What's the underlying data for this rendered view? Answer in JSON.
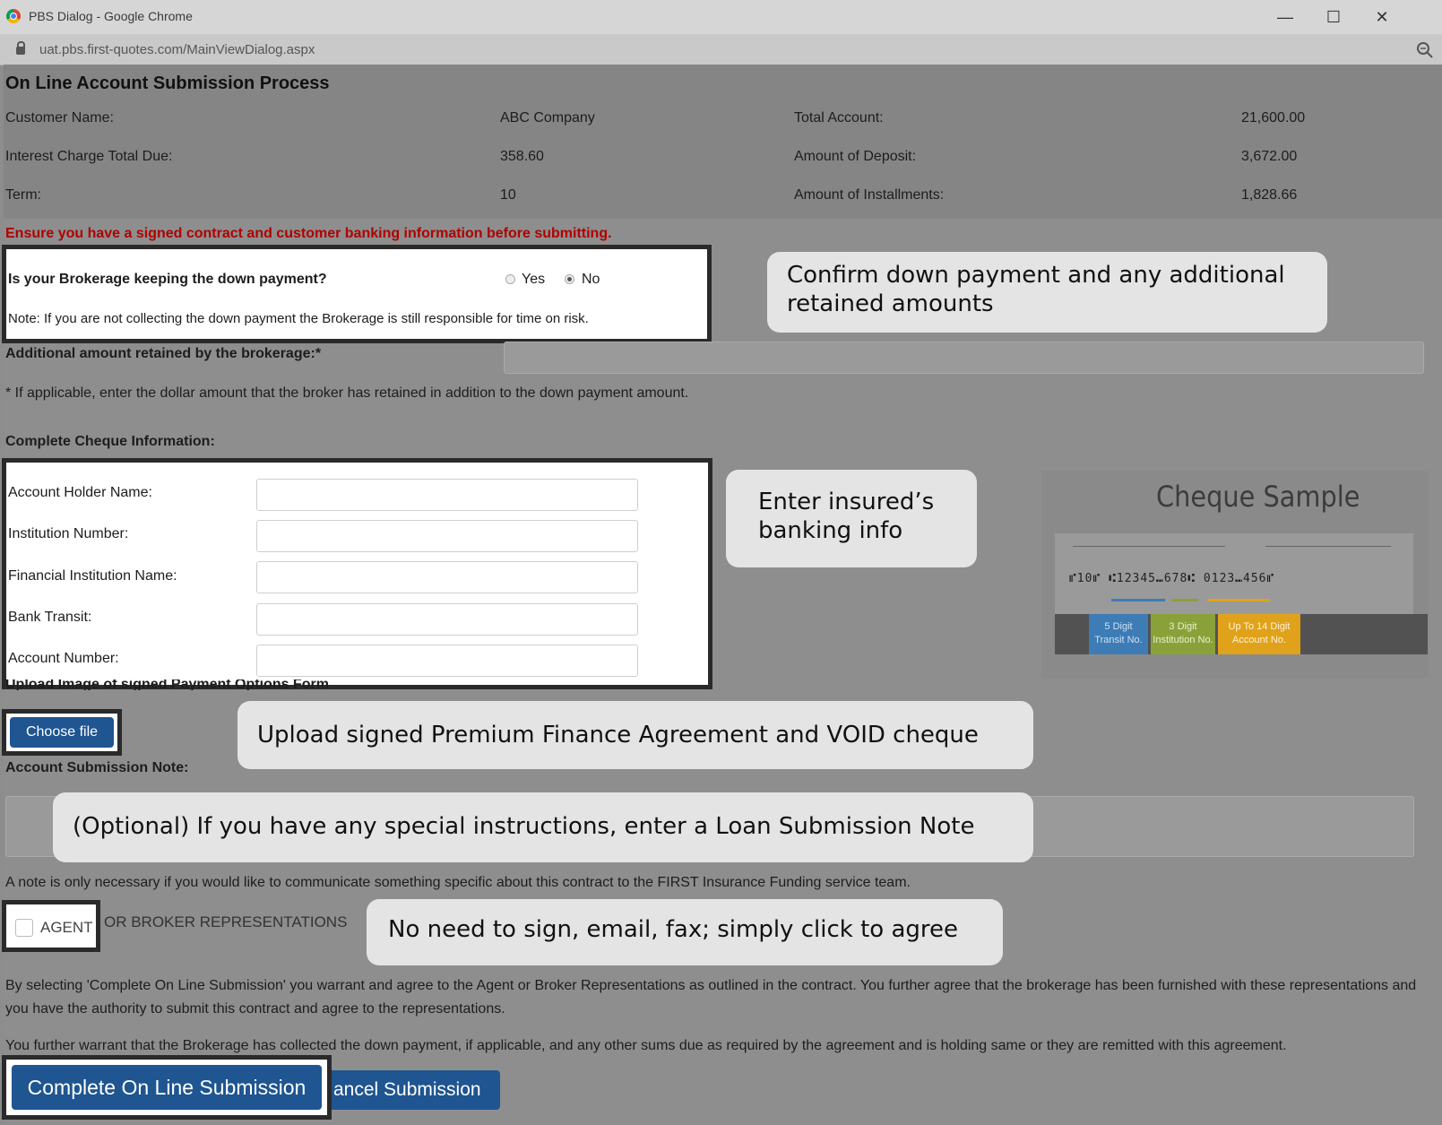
{
  "window": {
    "title": "PBS Dialog - Google Chrome",
    "url": "uat.pbs.first-quotes.com/MainViewDialog.aspx"
  },
  "page": {
    "heading": "On Line Account Submission Process",
    "summary": {
      "customer_name_label": "Customer Name:",
      "customer_name": "ABC Company",
      "total_account_label": "Total Account:",
      "total_account": "21,600.00",
      "interest_label": "Interest Charge Total Due:",
      "interest": "358.60",
      "deposit_label": "Amount of Deposit:",
      "deposit": "3,672.00",
      "term_label": "Term:",
      "term": "10",
      "installments_label": "Amount of Installments:",
      "installments": "1,828.66"
    },
    "warning": "Ensure you have a signed contract and customer banking information before submitting.",
    "down_payment": {
      "question": "Is your Brokerage keeping the down payment?",
      "yes_label": "Yes",
      "no_label": "No",
      "selected": "No",
      "note": "Note: If you are not collecting the down payment the Brokerage is still responsible for time on risk."
    },
    "additional": {
      "label": "Additional amount retained by the brokerage:*",
      "value": "",
      "help": "* If applicable, enter the dollar amount that the broker has retained in addition to the down payment amount."
    },
    "cheque": {
      "section_label": "Complete Cheque Information:",
      "fields": [
        {
          "label": "Account Holder Name:",
          "value": ""
        },
        {
          "label": "Institution Number:",
          "value": ""
        },
        {
          "label": "Financial Institution Name:",
          "value": ""
        },
        {
          "label": "Bank Transit:",
          "value": ""
        },
        {
          "label": "Account Number:",
          "value": ""
        }
      ],
      "sample_title": "Cheque Sample",
      "sample_micr": "⑈10⑈ ⑆12345⑉678⑆ 0123⑉456⑈",
      "sample_boxes": [
        "5 Digit Transit No.",
        "3 Digit Institution No.",
        "Up To 14 Digit Account No."
      ]
    },
    "upload": {
      "label": "Upload Image of signed Payment Options Form",
      "button": "Choose file"
    },
    "note": {
      "label": "Account Submission Note:",
      "value": "",
      "help": "A note is only necessary if you would like to communicate something specific about this contract to the FIRST Insurance Funding service team."
    },
    "agent": {
      "checkbox_label": "AGENT",
      "label_rest": "OR BROKER REPRESENTATIONS",
      "checked": false
    },
    "legal1": "By selecting 'Complete On Line Submission' you warrant and agree to the Agent or Broker Representations as outlined in the contract. You further agree that the brokerage has been furnished with these representations and you have the authority to submit this contract and agree to the representations.",
    "legal2": "You further warrant that the Brokerage has collected the down payment, if applicable, and any other sums due as required by the agreement and is holding same or they are remitted with this agreement.",
    "submit_button": "Complete On Line Submission",
    "cancel_button": "ancel Submission"
  },
  "callouts": {
    "down_payment": "Confirm down payment and any additional retained amounts",
    "banking": "Enter insured’s banking info",
    "upload": "Upload signed Premium Finance Agreement and VOID cheque",
    "note": "(Optional) If you have any special instructions, enter a Loan Submission Note",
    "agree": "No need to sign, email, fax; simply click to agree"
  },
  "colors": {
    "primary_button": "#1f5590",
    "warning": "#b00000",
    "cheque_transit": "#3d7cb5",
    "cheque_institution": "#8aa13a",
    "cheque_account": "#e0a21a"
  }
}
